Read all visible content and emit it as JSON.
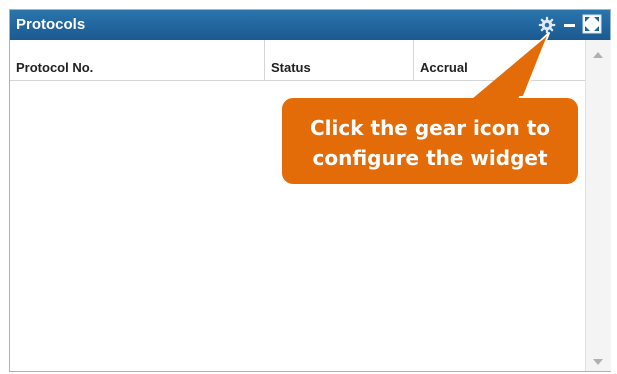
{
  "widget": {
    "title": "Protocols",
    "controls": {
      "gear": "gear-icon",
      "minimize": "minimize-icon",
      "maximize": "maximize-icon"
    }
  },
  "table": {
    "columns": [
      "Protocol No.",
      "Status",
      "Accrual"
    ],
    "rows": []
  },
  "callout": {
    "line1": "Click the gear icon to",
    "line2": "configure the widget",
    "color": "#e36c09"
  },
  "colors": {
    "titlebar": "#1f64a0",
    "accent": "#e36c09"
  }
}
